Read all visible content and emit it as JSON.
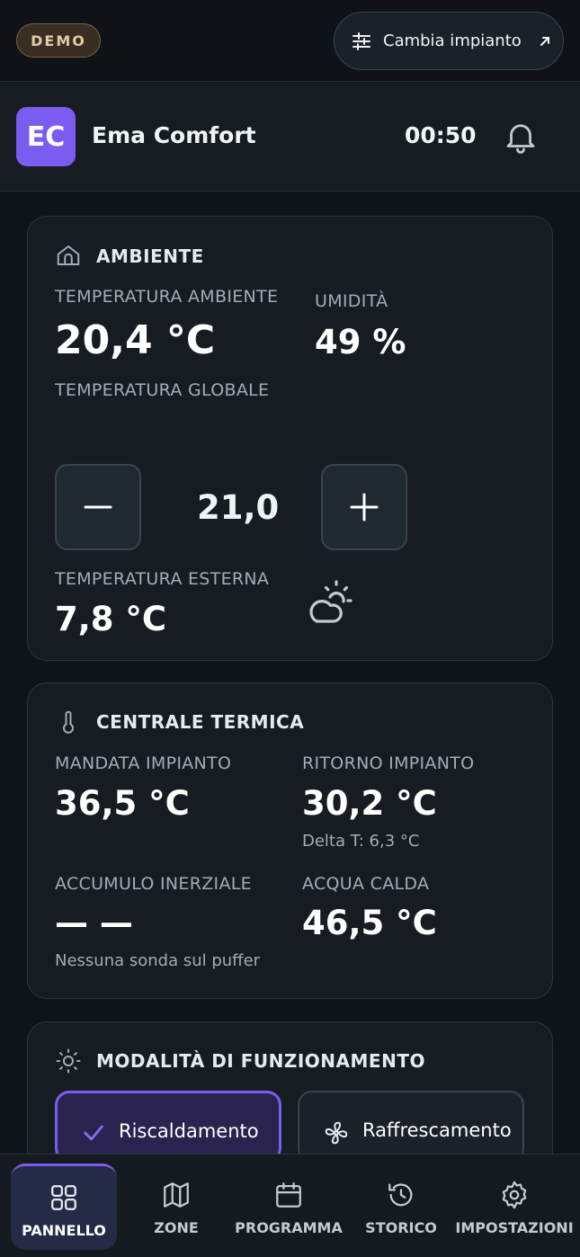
{
  "topbar": {
    "demo_label": "DEMO",
    "change_plant_label": "Cambia impianto"
  },
  "header": {
    "avatar_initials": "EC",
    "app_name": "Ema Comfort",
    "time": "00:50"
  },
  "ambiente": {
    "title": "AMBIENTE",
    "room_temp_label": "TEMPERATURA AMBIENTE",
    "room_temp_value": "20,4 °C",
    "humidity_label": "UMIDITÀ",
    "humidity_value": "49 %",
    "global_temp_label": "TEMPERATURA GLOBALE",
    "setpoint_value": "21,0",
    "outdoor_temp_label": "TEMPERATURA ESTERNA",
    "outdoor_temp_value": "7,8 °C"
  },
  "centrale": {
    "title": "CENTRALE TERMICA",
    "supply_label": "MANDATA IMPIANTO",
    "supply_value": "36,5 °C",
    "return_label": "RITORNO IMPIANTO",
    "return_value": "30,2 °C",
    "delta_text": "Delta T: 6,3 °C",
    "buffer_label": "ACCUMULO INERZIALE",
    "buffer_value": "— —",
    "buffer_note": "Nessuna sonda sul puffer",
    "dhw_label": "ACQUA CALDA",
    "dhw_value": "46,5 °C"
  },
  "modalita": {
    "title": "MODALITÀ DI FUNZIONAMENTO",
    "heating_label": "Riscaldamento",
    "cooling_label": "Raffrescamento",
    "selected": "Riscaldamento"
  },
  "nav": {
    "items": [
      {
        "label": "PANNELLO",
        "icon": "grid-icon",
        "active": true
      },
      {
        "label": "ZONE",
        "icon": "map-icon",
        "active": false
      },
      {
        "label": "PROGRAMMA",
        "icon": "calendar-icon",
        "active": false
      },
      {
        "label": "STORICO",
        "icon": "history-icon",
        "active": false
      },
      {
        "label": "IMPOSTAZIONI",
        "icon": "gear-icon",
        "active": false
      }
    ]
  },
  "colors": {
    "accent": "#7b5cf0",
    "background": "#0f1419",
    "card": "#161c22",
    "demo_badge": "#3a2e22"
  }
}
